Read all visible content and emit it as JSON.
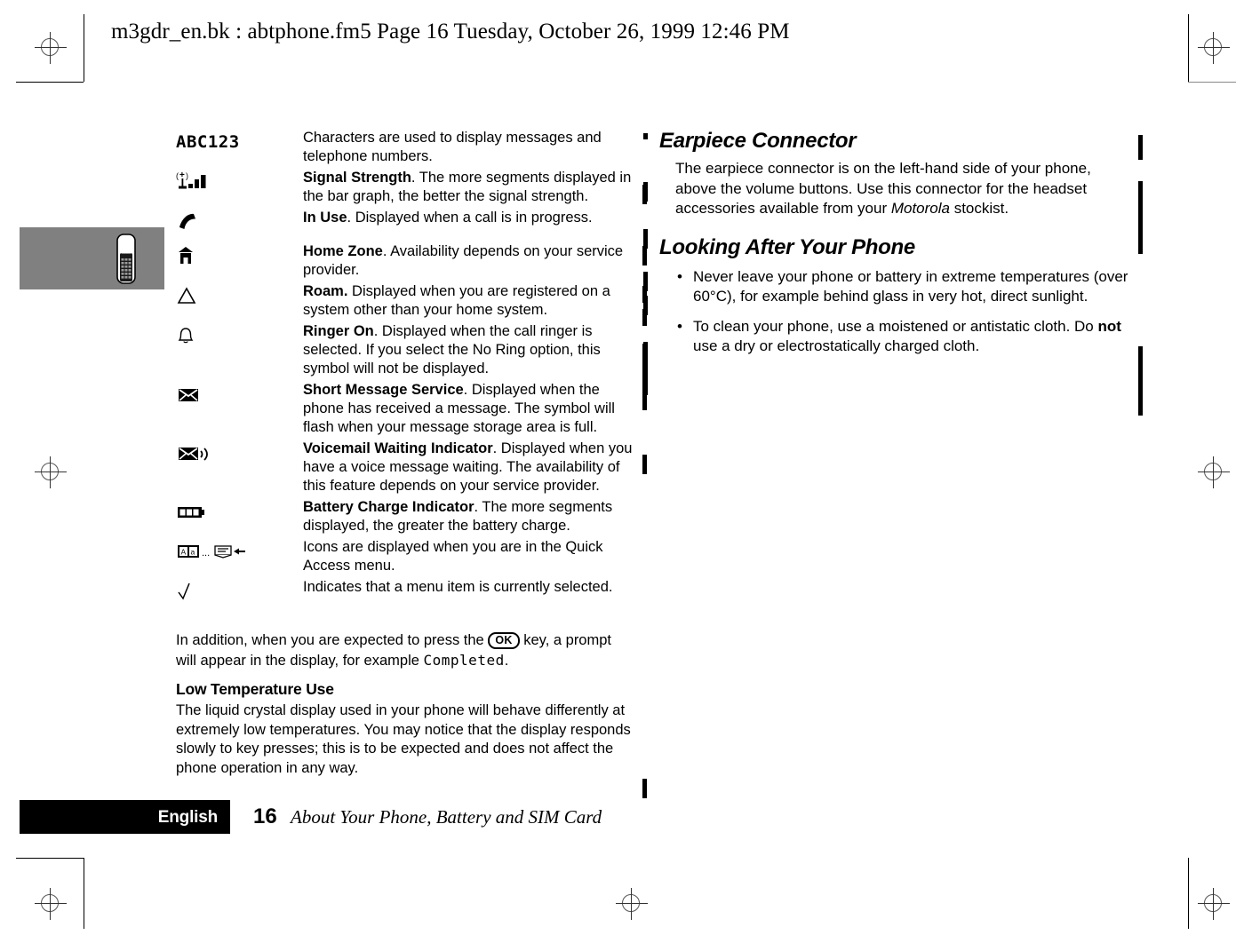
{
  "header": {
    "running_head": "m3gdr_en.bk : abtphone.fm5  Page 16  Tuesday, October 26, 1999  12:46 PM"
  },
  "left_column": {
    "symbol_table": [
      {
        "icon": "lcd-characters-icon",
        "icon_text": "ABC123",
        "term": "",
        "description": "Characters are used to display messages and telephone numbers."
      },
      {
        "icon": "signal-strength-icon",
        "icon_text": "",
        "term": "Signal Strength",
        "description": ". The more segments displayed in the bar graph, the better the signal strength."
      },
      {
        "icon": "in-use-handset-icon",
        "icon_text": "",
        "term": "In Use",
        "description": ". Displayed when a call is in progress."
      },
      {
        "icon": "home-zone-icon",
        "icon_text": "",
        "term": "Home Zone",
        "description": ". Availability depends on your service provider."
      },
      {
        "icon": "roam-triangle-icon",
        "icon_text": "",
        "term": "Roam.",
        "description": " Displayed when you are registered on a system other than your home system."
      },
      {
        "icon": "ringer-bell-icon",
        "icon_text": "",
        "term": "Ringer On",
        "description": ". Displayed when the call ringer is selected. If you select the No Ring option, this symbol will not be displayed."
      },
      {
        "icon": "envelope-icon",
        "icon_text": "",
        "term": "Short Message Service",
        "description": ". Displayed when the phone has received a message. The symbol will flash when your message storage area is full."
      },
      {
        "icon": "voicemail-envelope-waves-icon",
        "icon_text": "",
        "term": "Voicemail Waiting Indicator",
        "description": ". Displayed when you have a voice message waiting. The availability of this feature depends on your service provider."
      },
      {
        "icon": "battery-charge-icon",
        "icon_text": "",
        "term": "Battery Charge Indicator",
        "description": ". The more segments displayed, the greater the battery charge."
      },
      {
        "icon": "quick-access-menu-icons",
        "icon_text": "",
        "term": "",
        "description": "Icons are displayed when you are in the Quick Access menu."
      },
      {
        "icon": "checkmark-icon",
        "icon_text": "",
        "term": "",
        "description": "Indicates that a menu item is currently selected."
      }
    ],
    "in_addition": {
      "part1": "In addition, when you are expected to press the ",
      "ok_key": "OK",
      "part2": " key, a prompt will appear in the display, for example ",
      "example": "Completed",
      "part3": "."
    },
    "low_temp_heading": "Low Temperature Use",
    "low_temp_body": "The liquid crystal display used in your phone will behave differently at extremely low temperatures. You may notice that the display responds slowly to key presses; this is to be expected and does not affect the phone operation in any way."
  },
  "right_column": {
    "earpiece_heading": "Earpiece Connector",
    "earpiece_body_part1": "The earpiece connector is on the left-hand side of your phone, above the volume buttons. Use this connector for the headset accessories available from your ",
    "earpiece_body_italic": "Motorola",
    "earpiece_body_part2": " stockist.",
    "looking_after_heading": "Looking After Your Phone",
    "bullets": [
      {
        "marker": "•",
        "text": "Never leave your phone or battery in extreme temperatures (over 60°C), for example behind glass in very hot, direct sunlight."
      },
      {
        "marker": "•",
        "part1": "To clean your phone, use a moistened or antistatic cloth. Do ",
        "bold": "not",
        "part2": " use a dry or electrostatically charged cloth."
      }
    ]
  },
  "footer": {
    "language": "English",
    "page_number": "16",
    "section_title": "About Your Phone, Battery and SIM Card"
  },
  "colors": {
    "tab_box_gray": "#808080",
    "footer_black": "#000000",
    "text_black": "#000000"
  }
}
